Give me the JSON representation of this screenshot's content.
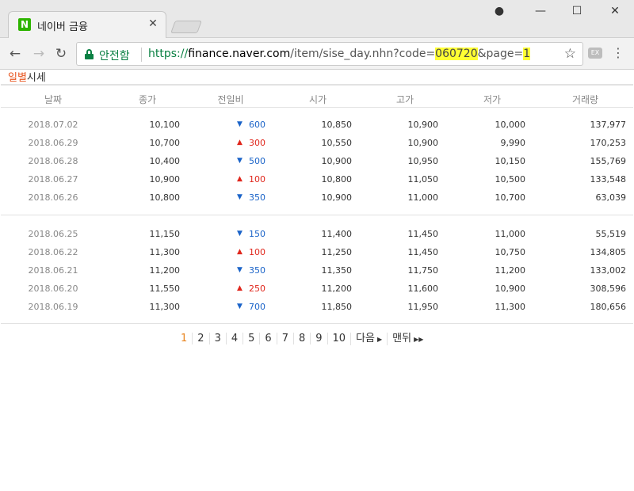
{
  "browser": {
    "tab_title": "네이버 금융",
    "tab_favicon_letter": "N",
    "secure_label": "안전함",
    "url": {
      "scheme": "https://",
      "host": "finance.naver.com",
      "path": "/item/sise_day.nhn?code=",
      "code": "060720",
      "page_param": "&page=",
      "page": "1"
    }
  },
  "page": {
    "heading_part1": "일별",
    "heading_part2": "시세"
  },
  "table": {
    "headers": {
      "date": "날짜",
      "close": "종가",
      "change": "전일비",
      "open": "시가",
      "high": "고가",
      "low": "저가",
      "volume": "거래량"
    },
    "groups": [
      [
        {
          "date": "2018.07.02",
          "close": "10,100",
          "dir": "down",
          "arrow": "▼",
          "change": "600",
          "open": "10,850",
          "high": "10,900",
          "low": "10,000",
          "volume": "137,977"
        },
        {
          "date": "2018.06.29",
          "close": "10,700",
          "dir": "up",
          "arrow": "▲",
          "change": "300",
          "open": "10,550",
          "high": "10,900",
          "low": "9,990",
          "volume": "170,253"
        },
        {
          "date": "2018.06.28",
          "close": "10,400",
          "dir": "down",
          "arrow": "▼",
          "change": "500",
          "open": "10,900",
          "high": "10,950",
          "low": "10,150",
          "volume": "155,769"
        },
        {
          "date": "2018.06.27",
          "close": "10,900",
          "dir": "up",
          "arrow": "▲",
          "change": "100",
          "open": "10,800",
          "high": "11,050",
          "low": "10,500",
          "volume": "133,548"
        },
        {
          "date": "2018.06.26",
          "close": "10,800",
          "dir": "down",
          "arrow": "▼",
          "change": "350",
          "open": "10,900",
          "high": "11,000",
          "low": "10,700",
          "volume": "63,039"
        }
      ],
      [
        {
          "date": "2018.06.25",
          "close": "11,150",
          "dir": "down",
          "arrow": "▼",
          "change": "150",
          "open": "11,400",
          "high": "11,450",
          "low": "11,000",
          "volume": "55,519"
        },
        {
          "date": "2018.06.22",
          "close": "11,300",
          "dir": "up",
          "arrow": "▲",
          "change": "100",
          "open": "11,250",
          "high": "11,450",
          "low": "10,750",
          "volume": "134,805"
        },
        {
          "date": "2018.06.21",
          "close": "11,200",
          "dir": "down",
          "arrow": "▼",
          "change": "350",
          "open": "11,350",
          "high": "11,750",
          "low": "11,200",
          "volume": "133,002"
        },
        {
          "date": "2018.06.20",
          "close": "11,550",
          "dir": "up",
          "arrow": "▲",
          "change": "250",
          "open": "11,200",
          "high": "11,600",
          "low": "10,900",
          "volume": "308,596"
        },
        {
          "date": "2018.06.19",
          "close": "11,300",
          "dir": "down",
          "arrow": "▼",
          "change": "700",
          "open": "11,850",
          "high": "11,950",
          "low": "11,300",
          "volume": "180,656"
        }
      ]
    ]
  },
  "pagination": {
    "pages": [
      "1",
      "2",
      "3",
      "4",
      "5",
      "6",
      "7",
      "8",
      "9",
      "10"
    ],
    "current": "1",
    "next_label": "다음",
    "last_label": "맨뒤"
  }
}
